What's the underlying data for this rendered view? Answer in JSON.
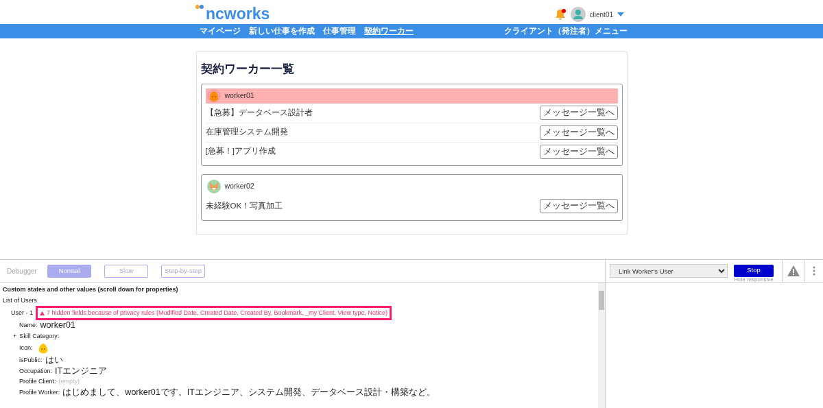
{
  "header": {
    "logo": "ncworks",
    "notification": true,
    "user": "client01"
  },
  "nav": {
    "items": [
      {
        "label": "マイページ",
        "selected": false
      },
      {
        "label": "新しい仕事を作成",
        "selected": false
      },
      {
        "label": "仕事管理",
        "selected": false
      },
      {
        "label": "契約ワーカー",
        "selected": true
      }
    ],
    "menu": "クライアント（発注者）メニュー"
  },
  "page_title": "契約ワーカー一覧",
  "workers": [
    {
      "name": "worker01",
      "highlighted": true,
      "kind": "chick",
      "jobs": [
        {
          "title": "【急募】データベース設計者",
          "button": "メッセージ一覧へ"
        },
        {
          "title": "在庫管理システム開発",
          "button": "メッセージ一覧へ"
        },
        {
          "title": "[急募！]アプリ作成",
          "button": "メッセージ一覧へ"
        }
      ]
    },
    {
      "name": "worker02",
      "highlighted": false,
      "kind": "fox",
      "jobs": [
        {
          "title": "未経験OK！写真加工",
          "button": "メッセージ一覧へ"
        }
      ]
    }
  ],
  "debugger": {
    "label": "Debugger",
    "modes": [
      {
        "label": "Normal",
        "selected": true
      },
      {
        "label": "Slow",
        "selected": false
      },
      {
        "label": "Step-by-step",
        "selected": false
      }
    ],
    "element_select": {
      "value": "Link Worker's User"
    },
    "stop_button": "Stop",
    "hide_responsive": "Hide responsive",
    "heading": "Custom states and other values (scroll down for properties)",
    "tree": [
      {
        "label": "List of Users",
        "children": [
          {
            "label": "User - 1",
            "warning": "7 hidden fields because of privacy rules (Modified Date, Created Date, Created By, Bookmark, _my Client, View type, Notice)",
            "children": [
              {
                "kind": "text",
                "label": "Name:",
                "value": "worker01"
              },
              {
                "kind": "expandable",
                "toggle": "+",
                "label": "Skill Category:"
              },
              {
                "kind": "image",
                "label": "Icon:"
              },
              {
                "kind": "text",
                "label": "isPublic:",
                "value": "はい"
              },
              {
                "kind": "text",
                "label": "Occupation:",
                "value": "ITエンジニア"
              },
              {
                "kind": "empty",
                "label": "Profile Client:",
                "value": "(empty)"
              },
              {
                "kind": "text",
                "label": "Profile Worker:",
                "value": "はじめまして、worker01です。ITエンジニア、システム開発、データベース設計・構築など。"
              }
            ]
          }
        ]
      }
    ]
  }
}
